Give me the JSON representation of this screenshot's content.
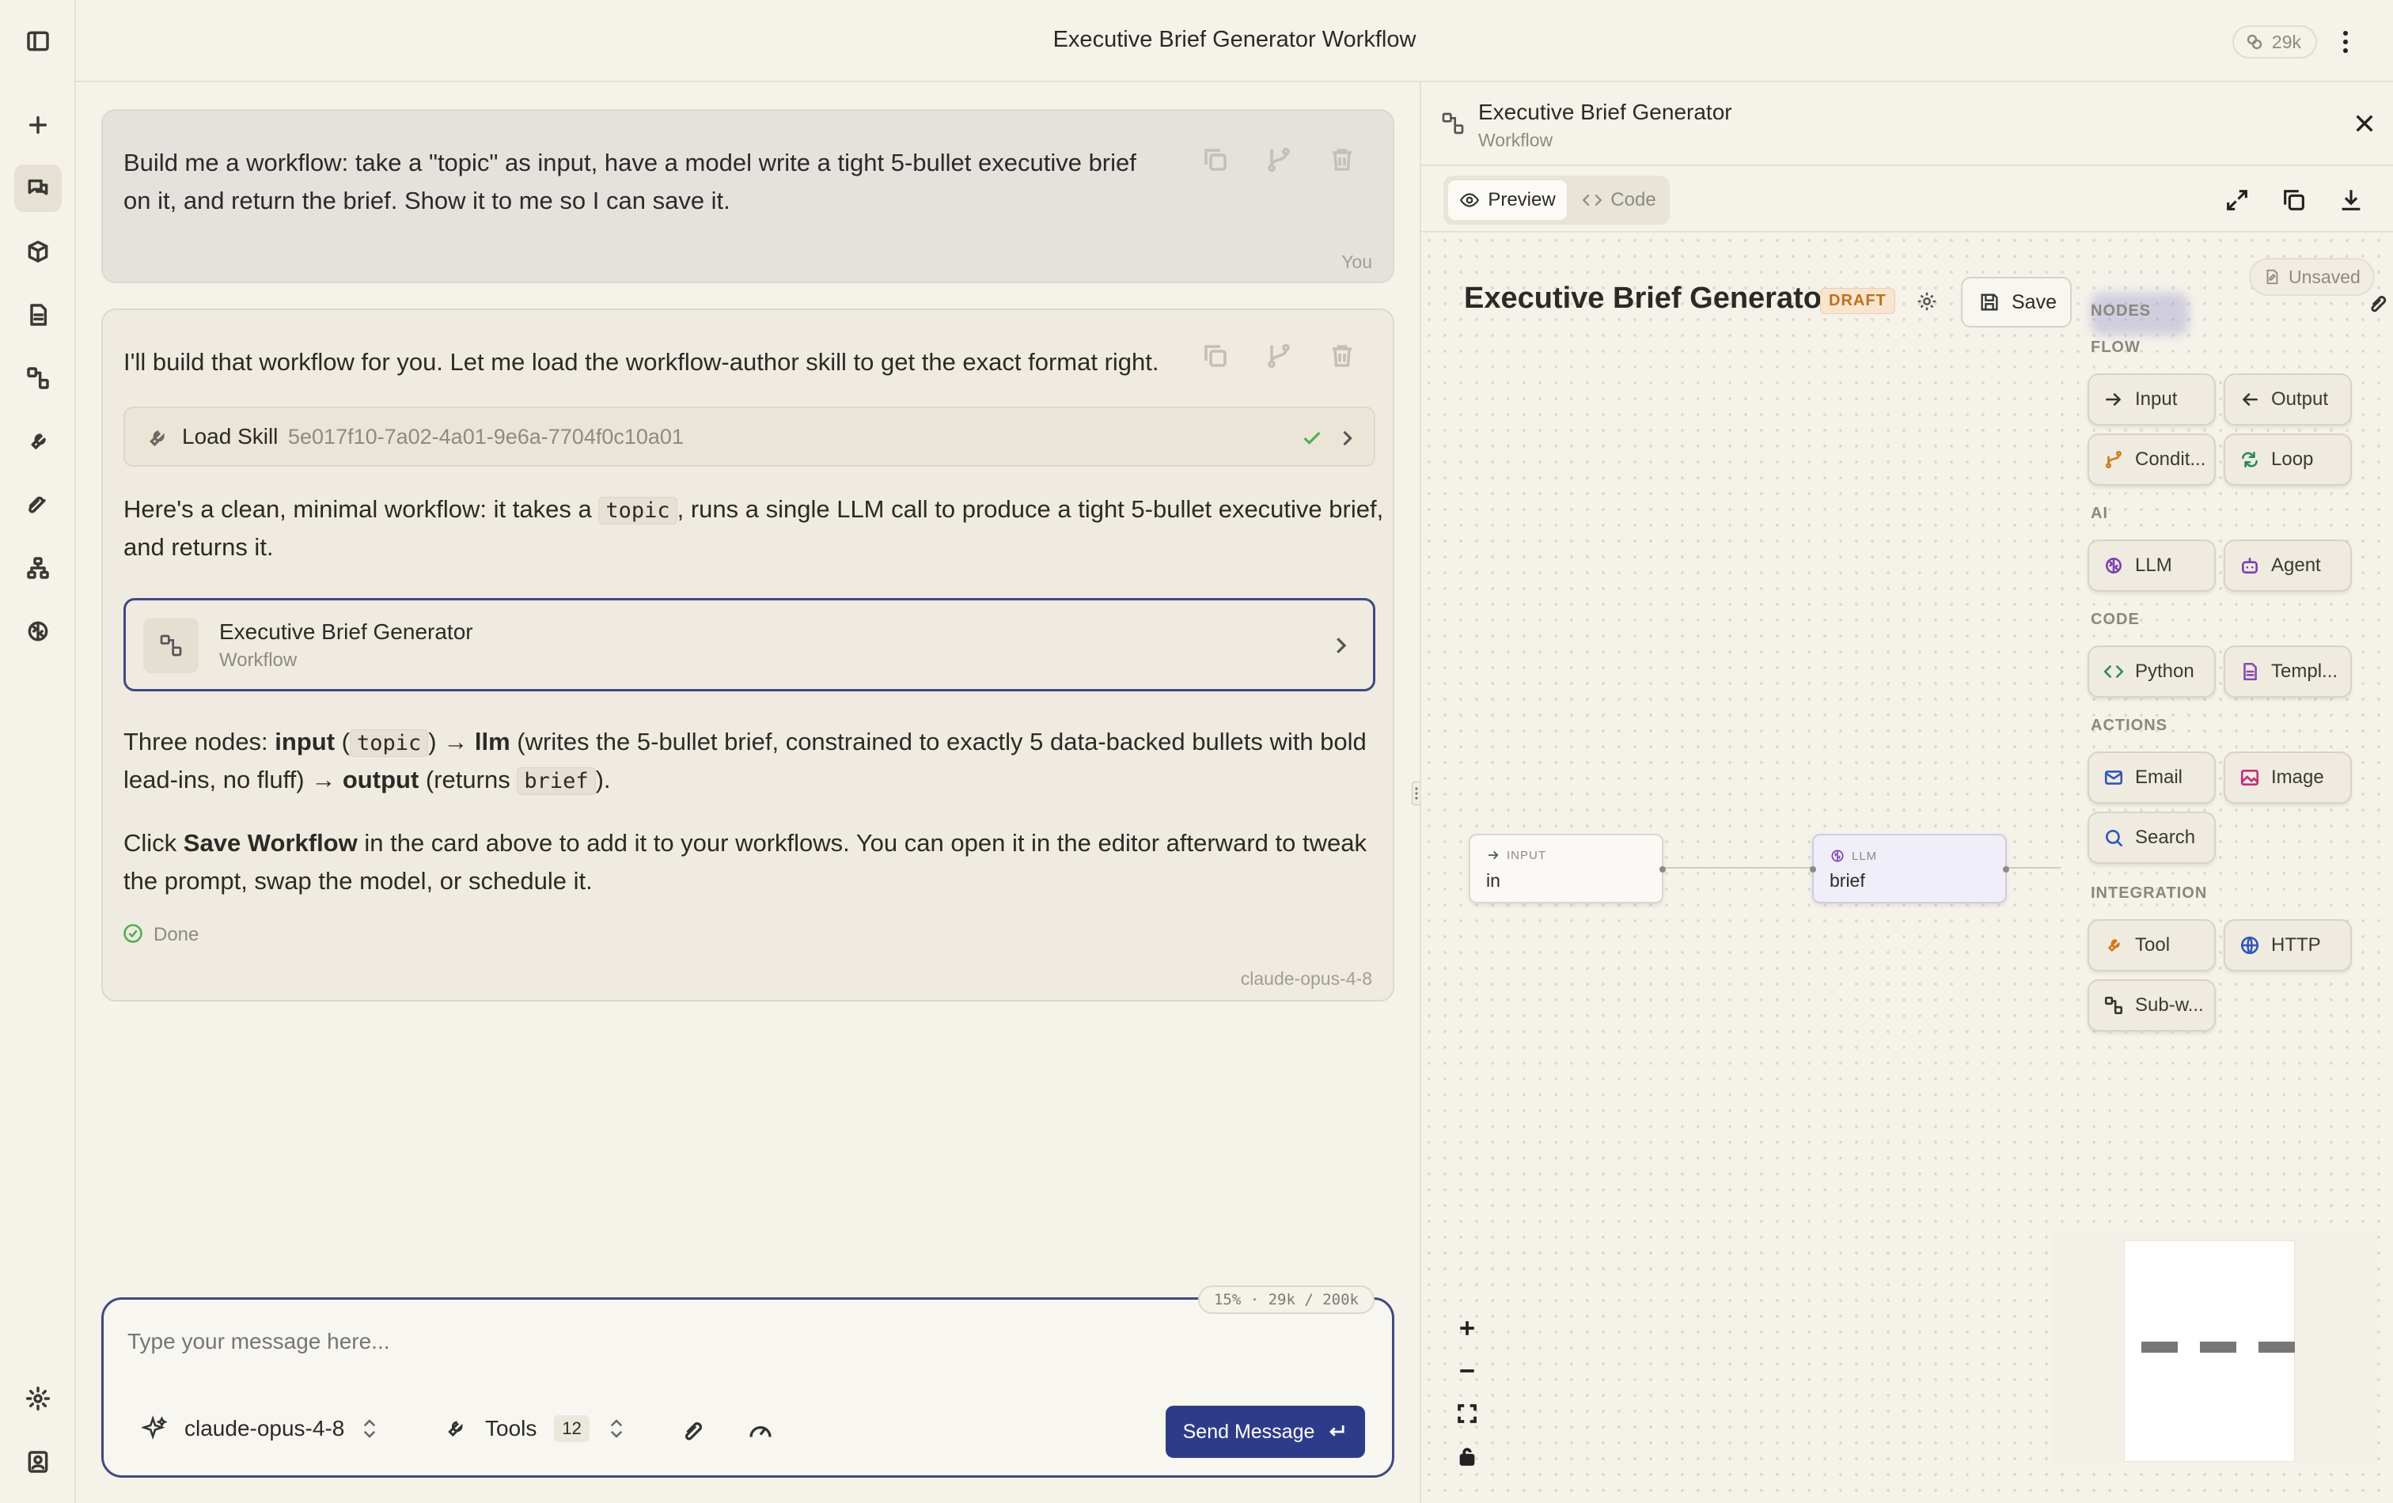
{
  "header": {
    "title": "Executive Brief Generator Workflow",
    "token_count": "29k"
  },
  "user_message": {
    "line1": "Build me a workflow: take a \"topic\" as input, have a model write a tight 5-bullet executive brief",
    "line2": "on it, and return the brief. Show it to me so I can save it.",
    "sender": "You"
  },
  "assistant_message": {
    "intro": "I'll build that workflow for you. Let me load the workflow-author skill to get the exact format right.",
    "skill": {
      "label": "Load Skill",
      "id": "5e017f10-7a02-4a01-9e6a-7704f0c10a01"
    },
    "para1_a": "Here's a clean, minimal workflow: it takes a",
    "para1_code": "topic",
    "para1_b": ", runs a single LLM call to produce a tight 5-bullet executive brief,",
    "para1_c": "and returns it.",
    "card": {
      "title": "Executive Brief Generator",
      "subtitle": "Workflow"
    },
    "nodes_line": {
      "prefix": "Three nodes:",
      "input": "input",
      "open": "(",
      "topic": "topic",
      "close": ")",
      "arrow1": "→",
      "llm": "llm",
      "llm_desc_1": "(writes the 5-bullet brief, constrained to exactly 5 data-backed bullets with bold",
      "llm_desc_2": "lead-ins, no fluff)",
      "arrow2": "→",
      "output": "output",
      "returns": "(returns",
      "brief": "brief",
      "end": ")."
    },
    "save_line": {
      "a": "Click",
      "bold": "Save Workflow",
      "b": "in the card above to add it to your workflows. You can open it in the editor afterward to tweak",
      "c": "the prompt, swap the model, or schedule it."
    },
    "status": "Done",
    "model": "claude-opus-4-8"
  },
  "composer": {
    "placeholder": "Type your message here...",
    "context_usage": "15% · 29k / 200k",
    "model": "claude-opus-4-8",
    "tools_label": "Tools",
    "tools_count": "12",
    "send_label": "Send Message"
  },
  "panel": {
    "title": "Executive Brief Generator",
    "subtitle": "Workflow",
    "tabs": [
      {
        "label": "Preview",
        "active": true
      },
      {
        "label": "Code",
        "active": false
      }
    ],
    "editor": {
      "workflow_name": "Executive Brief Generator",
      "badge": "DRAFT",
      "save_label": "Save",
      "unsaved_label": "Unsaved"
    },
    "palette": {
      "header": "NODES",
      "sections": [
        {
          "label": "FLOW",
          "items": [
            "Input",
            "Output",
            "Condit...",
            "Loop"
          ]
        },
        {
          "label": "AI",
          "items": [
            "LLM",
            "Agent"
          ]
        },
        {
          "label": "CODE",
          "items": [
            "Python",
            "Templ..."
          ]
        },
        {
          "label": "ACTIONS",
          "items": [
            "Email",
            "Image",
            "Search"
          ]
        },
        {
          "label": "INTEGRATION",
          "items": [
            "Tool",
            "HTTP",
            "Sub-w..."
          ]
        }
      ]
    },
    "graph": {
      "nodes": [
        {
          "kind": "INPUT",
          "name": "in"
        },
        {
          "kind": "LLM",
          "name": "brief"
        }
      ]
    }
  },
  "colors": {
    "accent": "#2d3c8a",
    "draft": "#c0701a",
    "success": "#4caf50"
  }
}
